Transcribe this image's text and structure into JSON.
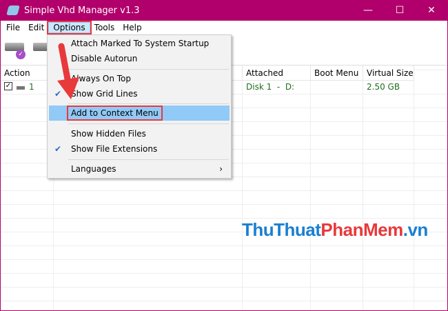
{
  "title": "Simple Vhd Manager v1.3",
  "window_controls": {
    "minimize": "—",
    "maximize": "☐",
    "close": "✕"
  },
  "menubar": [
    "File",
    "Edit",
    "Options",
    "Tools",
    "Help"
  ],
  "table": {
    "headers": [
      "Action",
      "Attached",
      "Boot Menu",
      "Virtual Size"
    ],
    "rows": [
      {
        "number": "1",
        "attached": "Disk 1  -  D:",
        "boot_menu": "",
        "virtual_size": "2.50 GB"
      }
    ]
  },
  "options_menu": [
    {
      "label": "Attach Marked To System Startup",
      "checked": false
    },
    {
      "label": "Disable Autorun",
      "checked": false
    },
    {
      "label": "Always On Top",
      "checked": false
    },
    {
      "label": "Show Grid Lines",
      "checked": true
    },
    {
      "label": "Add to Context Menu",
      "checked": false,
      "highlighted": true
    },
    {
      "label": "Show Hidden Files",
      "checked": false
    },
    {
      "label": "Show File Extensions",
      "checked": true
    },
    {
      "label": "Languages",
      "submenu": "›"
    }
  ],
  "watermark": {
    "part1": "ThuThuat",
    "part2": "PhanMem",
    "part3": ".vn"
  },
  "colors": {
    "titlebar": "#b1006b",
    "highlight": "#91c9f7",
    "annotation": "#e8393b"
  }
}
